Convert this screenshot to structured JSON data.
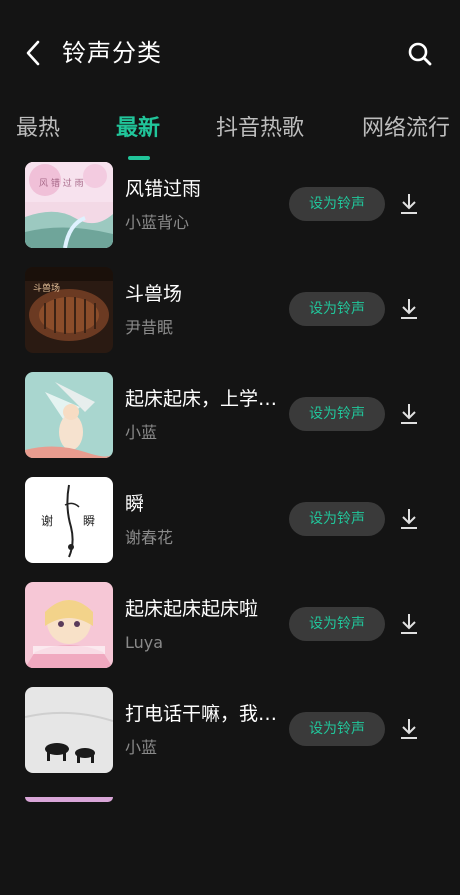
{
  "header": {
    "title": "铃声分类",
    "back_icon": "back-arrow-icon",
    "search_icon": "search-icon"
  },
  "tabs": [
    {
      "label": "最热",
      "active": false
    },
    {
      "label": "最新",
      "active": true
    },
    {
      "label": "抖音热歌",
      "active": false
    },
    {
      "label": "网络流行",
      "active": false
    }
  ],
  "colors": {
    "accent": "#21c59a",
    "background": "#141414",
    "button_bg": "#3a3a3a",
    "secondary_text": "#8a8a8a"
  },
  "ringtones": [
    {
      "title": "风错过雨",
      "artist": "小蓝背心",
      "set_label": "设为铃声"
    },
    {
      "title": "斗兽场",
      "artist": "尹昔眠",
      "set_label": "设为铃声"
    },
    {
      "title": "起床起床，上学…",
      "artist": "小蓝",
      "set_label": "设为铃声"
    },
    {
      "title": "瞬",
      "artist": "谢春花",
      "set_label": "设为铃声"
    },
    {
      "title": "起床起床起床啦",
      "artist": "Luya",
      "set_label": "设为铃声"
    },
    {
      "title": "打电话干嘛，我…",
      "artist": "小蓝",
      "set_label": "设为铃声"
    }
  ]
}
